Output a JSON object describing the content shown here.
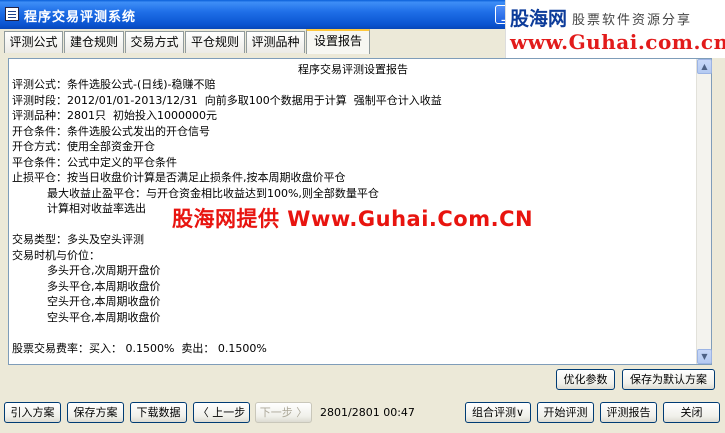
{
  "window": {
    "title": "程序交易评测系统",
    "minimize_glyph": "_"
  },
  "watermark_banner": {
    "brand": "股海网",
    "slogan": "股票软件资源分享",
    "url": "www.Guhai.com.cn"
  },
  "overlay_watermark": "股海网提供 Www.Guhai.Com.CN",
  "tabs": [
    {
      "label": "评测公式"
    },
    {
      "label": "建仓规则"
    },
    {
      "label": "交易方式"
    },
    {
      "label": "平仓规则"
    },
    {
      "label": "评测品种"
    },
    {
      "label": "设置报告",
      "active": true
    }
  ],
  "report": {
    "title": "程序交易评测设置报告",
    "lines": [
      "评测公式：条件选股公式-(日线)-稳赚不赔",
      "评测时段：2012/01/01-2013/12/31  向前多取100个数据用于计算  强制平仓计入收益",
      "评测品种：2801只  初始投入1000000元",
      "开仓条件：条件选股公式发出的开仓信号",
      "开仓方式：使用全部资金开仓",
      "平仓条件：公式中定义的平仓条件",
      "止损平仓：按当日收盘价计算是否满足止损条件,按本周期收盘价平仓",
      "          最大收益止盈平仓：与开仓资金相比收益达到100%,则全部数量平仓",
      "          计算相对收益率选出",
      "",
      "交易类型：多头及空头评测",
      "交易时机与价位：",
      "          多头开仓,次周期开盘价",
      "          多头平仓,本周期收盘价",
      "          空头开仓,本周期收盘价",
      "          空头平仓,本周期收盘价",
      "",
      "股票交易费率：买入： 0.1500%  卖出： 0.1500%"
    ]
  },
  "option_buttons": {
    "optimize": "优化参数",
    "save_default": "保存为默认方案"
  },
  "toolbar": {
    "import": "引入方案",
    "save": "保存方案",
    "download": "下载数据",
    "prev": "〈 上一步",
    "next": "下一步 〉",
    "progress": "2801/2801  00:47",
    "combo": "组合评测∨",
    "start": "开始评测",
    "report": "评测报告",
    "close": "关闭"
  }
}
